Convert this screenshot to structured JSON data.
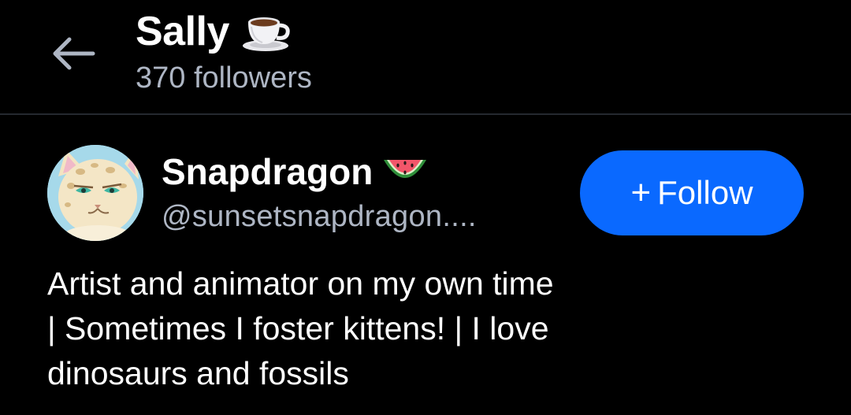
{
  "header": {
    "title": "Sally",
    "title_emoji": "coffee-cup-emoji",
    "followers_text": "370 followers",
    "back_icon": "arrow-left-icon"
  },
  "profile": {
    "display_name": "Snapdragon",
    "name_emoji": "watermelon-emoji",
    "handle": "@sunsetsnapdragon....",
    "avatar": "cat-avatar",
    "follow_button": {
      "plus": "+",
      "label": "Follow"
    },
    "bio_lines": [
      "Artist and animator on my own time",
      "| Sometimes I foster kittens! | I love",
      "dinosaurs and fossils"
    ]
  },
  "colors": {
    "background": "#000000",
    "text_primary": "#ffffff",
    "text_secondary": "#aeb6c4",
    "divider": "#25292f",
    "accent": "#0a69ff"
  }
}
